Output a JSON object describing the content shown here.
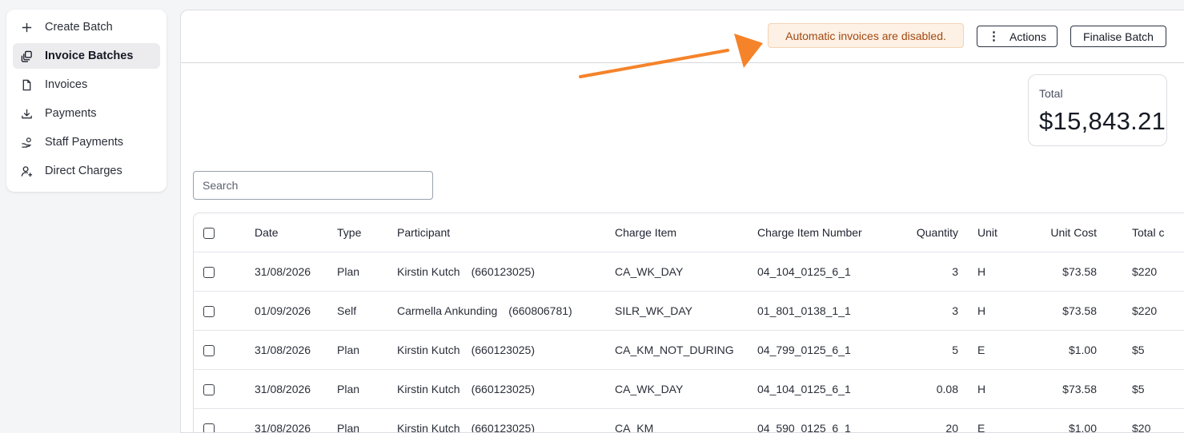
{
  "sidebar": {
    "items": [
      {
        "label": "Create Batch",
        "icon": "plus-icon",
        "active": false
      },
      {
        "label": "Invoice Batches",
        "icon": "batches-icon",
        "active": true
      },
      {
        "label": "Invoices",
        "icon": "document-icon",
        "active": false
      },
      {
        "label": "Payments",
        "icon": "download-icon",
        "active": false
      },
      {
        "label": "Staff Payments",
        "icon": "hand-coins-icon",
        "active": false
      },
      {
        "label": "Direct Charges",
        "icon": "user-plus-icon",
        "active": false
      }
    ]
  },
  "header": {
    "alert": "Automatic invoices are disabled.",
    "actions_label": "Actions",
    "finalise_label": "Finalise Batch"
  },
  "total": {
    "label": "Total",
    "value": "$15,843.21"
  },
  "search": {
    "placeholder": "Search",
    "value": ""
  },
  "table": {
    "columns": [
      "Date",
      "Type",
      "Participant",
      "Charge Item",
      "Charge Item Number",
      "Quantity",
      "Unit",
      "Unit Cost",
      "Total c"
    ],
    "rows": [
      {
        "date": "31/08/2026",
        "type": "Plan",
        "participant": "Kirstin Kutch",
        "participant_id": "(660123025)",
        "charge_item": "CA_WK_DAY",
        "charge_item_number": "04_104_0125_6_1",
        "quantity": "3",
        "unit": "H",
        "unit_cost": "$73.58",
        "total": "$220"
      },
      {
        "date": "01/09/2026",
        "type": "Self",
        "participant": "Carmella Ankunding",
        "participant_id": "(660806781)",
        "charge_item": "SILR_WK_DAY",
        "charge_item_number": "01_801_0138_1_1",
        "quantity": "3",
        "unit": "H",
        "unit_cost": "$73.58",
        "total": "$220"
      },
      {
        "date": "31/08/2026",
        "type": "Plan",
        "participant": "Kirstin Kutch",
        "participant_id": "(660123025)",
        "charge_item": "CA_KM_NOT_DURING",
        "charge_item_number": "04_799_0125_6_1",
        "quantity": "5",
        "unit": "E",
        "unit_cost": "$1.00",
        "total": "$5"
      },
      {
        "date": "31/08/2026",
        "type": "Plan",
        "participant": "Kirstin Kutch",
        "participant_id": "(660123025)",
        "charge_item": "CA_WK_DAY",
        "charge_item_number": "04_104_0125_6_1",
        "quantity": "0.08",
        "unit": "H",
        "unit_cost": "$73.58",
        "total": "$5"
      },
      {
        "date": "31/08/2026",
        "type": "Plan",
        "participant": "Kirstin Kutch",
        "participant_id": "(660123025)",
        "charge_item": "CA_KM",
        "charge_item_number": "04_590_0125_6_1",
        "quantity": "20",
        "unit": "E",
        "unit_cost": "$1.00",
        "total": "$20"
      }
    ]
  },
  "colors": {
    "accent_arrow": "#f5832a",
    "alert_bg": "#fdf0e4",
    "alert_text": "#a04a12",
    "active_nav_bg": "#ececef"
  }
}
